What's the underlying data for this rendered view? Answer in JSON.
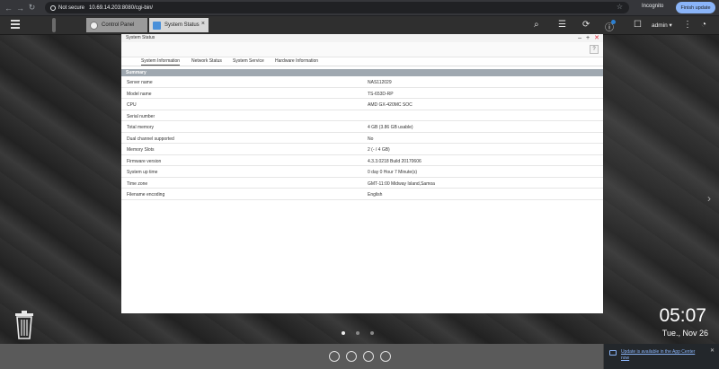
{
  "browser": {
    "not_secure": "Not secure",
    "url": "10.69.14.203:8080/cgi-bin/",
    "incognito": "Incognito",
    "finish_update": "Finish update"
  },
  "qts": {
    "tabs": [
      {
        "label": "Control Panel"
      },
      {
        "label": "System Status"
      }
    ],
    "user": "admin ▾"
  },
  "window": {
    "title": "System Status",
    "tabs": [
      {
        "label": "System Information"
      },
      {
        "label": "Network Status"
      },
      {
        "label": "System Service"
      },
      {
        "label": "Hardware Information"
      }
    ],
    "section": "Summary",
    "rows": [
      {
        "label": "Server name",
        "value": "NAS112029"
      },
      {
        "label": "Model name",
        "value": "TS-653D-RP"
      },
      {
        "label": "CPU",
        "value": "AMD GX-420MC SOC"
      },
      {
        "label": "Serial number",
        "value": ""
      },
      {
        "label": "Total memory",
        "value": "4 GB (3.86 GB usable)"
      },
      {
        "label": "Dual channel supported",
        "value": "No"
      },
      {
        "label": "Memory Slots",
        "value": "2 (- / 4 GB)"
      },
      {
        "label": "Firmware version",
        "value": "4.3.3.0218 Build 20170606"
      },
      {
        "label": "System up time",
        "value": "0 day 0 Hour 7 Minute(s)"
      },
      {
        "label": "Time zone",
        "value": "GMT-11:00 Midway Island,Samoa"
      },
      {
        "label": "Filename encoding",
        "value": "English"
      }
    ]
  },
  "desktop": {
    "time": "05:07",
    "date": "Tue., Nov 26"
  },
  "notification": {
    "text": "Update is available in the App Center now"
  }
}
